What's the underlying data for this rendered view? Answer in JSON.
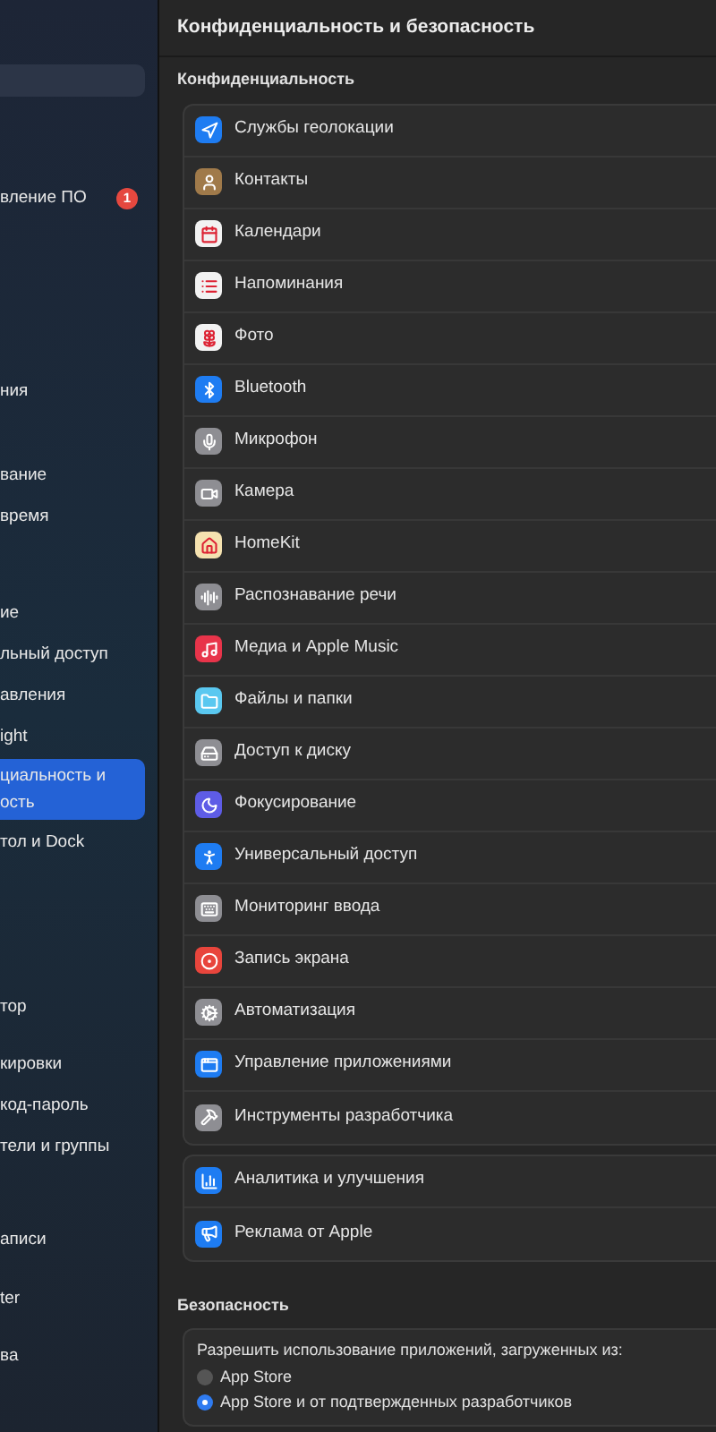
{
  "sidebar": {
    "groups": [
      [
        {
          "label": "вление ПО",
          "badge": "1",
          "selected": false
        }
      ],
      [
        {
          "label": "ния",
          "selected": false
        }
      ],
      [
        {
          "label": "вание",
          "selected": false
        },
        {
          "label": "время",
          "selected": false
        }
      ],
      [
        {
          "label": "ие",
          "selected": false
        },
        {
          "label": "льный доступ",
          "selected": false
        },
        {
          "label": "авления",
          "selected": false
        },
        {
          "label": "ight",
          "selected": false
        },
        {
          "label": "циальность и\nость",
          "selected": true
        },
        {
          "label": "тол и Dock",
          "selected": false
        }
      ],
      [
        {
          "label": "тор",
          "selected": false
        }
      ],
      [
        {
          "label": "кировки",
          "selected": false
        },
        {
          "label": "код-пароль",
          "selected": false
        },
        {
          "label": "тели и группы",
          "selected": false
        }
      ],
      [
        {
          "label": "аписи",
          "selected": false
        }
      ],
      [
        {
          "label": "ter",
          "selected": false
        }
      ],
      [
        {
          "label": "ва",
          "selected": false
        }
      ]
    ]
  },
  "main": {
    "title": "Конфиденциальность и безопасность",
    "privacy": {
      "heading": "Конфиденциальность",
      "rows": [
        {
          "label": "Службы геолокации",
          "kind": "location",
          "color": "#1e7cf2"
        },
        {
          "label": "Контакты",
          "kind": "contacts",
          "color": "#a07a4a"
        },
        {
          "label": "Календари",
          "kind": "calendar",
          "color": "#f2f2f2"
        },
        {
          "label": "Напоминания",
          "kind": "reminders",
          "color": "#f2f2f2"
        },
        {
          "label": "Фото",
          "kind": "photos",
          "color": "#f2f2f2"
        },
        {
          "label": "Bluetooth",
          "kind": "bluetooth",
          "color": "#1e7cf2"
        },
        {
          "label": "Микрофон",
          "kind": "microphone",
          "color": "#8e8e93"
        },
        {
          "label": "Камера",
          "kind": "camera",
          "color": "#8e8e93"
        },
        {
          "label": "HomeKit",
          "kind": "home",
          "color": "#f5e2b0"
        },
        {
          "label": "Распознавание речи",
          "kind": "speech",
          "color": "#8e8e93"
        },
        {
          "label": "Медиа и Apple Music",
          "kind": "music",
          "color": "#e8344a"
        },
        {
          "label": "Файлы и папки",
          "kind": "folder",
          "color": "#5ac8f0"
        },
        {
          "label": "Доступ к диску",
          "kind": "disk",
          "color": "#8e8e93"
        },
        {
          "label": "Фокусирование",
          "kind": "focus",
          "color": "#5e5ce6"
        },
        {
          "label": "Универсальный доступ",
          "kind": "accessibility",
          "color": "#1e7cf2"
        },
        {
          "label": "Мониторинг ввода",
          "kind": "keyboard",
          "color": "#8e8e93"
        },
        {
          "label": "Запись экрана",
          "kind": "record",
          "color": "#e8453c"
        },
        {
          "label": "Автоматизация",
          "kind": "automation",
          "color": "#8e8e93"
        },
        {
          "label": "Управление приложениями",
          "kind": "appstore",
          "color": "#1e7cf2"
        },
        {
          "label": "Инструменты разработчика",
          "kind": "developer",
          "color": "#8e8e93"
        }
      ]
    },
    "extra": {
      "rows": [
        {
          "label": "Аналитика и улучшения",
          "kind": "analytics",
          "color": "#1e7cf2"
        },
        {
          "label": "Реклама от Apple",
          "kind": "ads",
          "color": "#1e7cf2"
        }
      ]
    },
    "security": {
      "heading": "Безопасность",
      "prompt": "Разрешить использование приложений, загруженных из:",
      "options": [
        {
          "label": "App Store",
          "selected": false
        },
        {
          "label": "App Store и от подтвержденных разработчиков",
          "selected": true
        }
      ]
    }
  }
}
